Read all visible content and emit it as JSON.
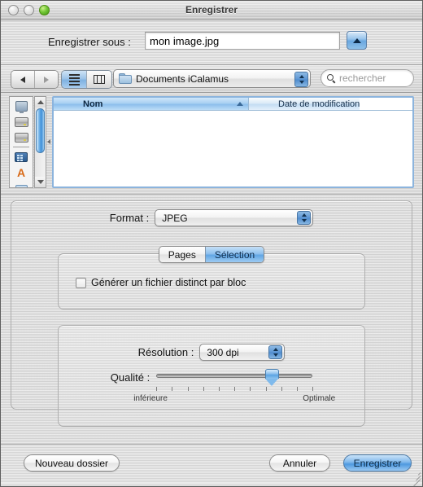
{
  "window": {
    "title": "Enregistrer",
    "traffic_lights": [
      {
        "name": "close",
        "state": "inactive"
      },
      {
        "name": "minimize",
        "state": "inactive"
      },
      {
        "name": "zoom",
        "state": "green"
      }
    ]
  },
  "saveas": {
    "label": "Enregistrer sous :",
    "filename": "mon image.jpg",
    "disclosure_icon": "triangle-up-icon"
  },
  "toolbar": {
    "back_icon": "arrow-left-icon",
    "forward_icon": "arrow-right-icon",
    "view_list_icon": "list-view-icon",
    "view_column_icon": "column-view-icon",
    "active_view": "list",
    "location": "Documents iCalamus",
    "location_icon": "folder-icon",
    "search_placeholder": "rechercher",
    "search_icon": "search-icon"
  },
  "sidebar": {
    "items": [
      {
        "name": "computer",
        "icon": "display-icon"
      },
      {
        "name": "disk-1",
        "icon": "hard-drive-icon"
      },
      {
        "name": "disk-2",
        "icon": "hard-drive-icon"
      },
      {
        "name": "separator",
        "icon": "separator"
      },
      {
        "name": "network",
        "icon": "server-icon"
      },
      {
        "name": "applications",
        "icon": "applications-icon",
        "glyph": "A"
      },
      {
        "name": "documents",
        "icon": "folder-icon"
      }
    ]
  },
  "filelist": {
    "columns": [
      {
        "label": "Nom",
        "sorted": true,
        "sort_icon": "sort-ascending-icon"
      },
      {
        "label": "Date de modification",
        "sorted": false
      }
    ],
    "rows": []
  },
  "options": {
    "format": {
      "label": "Format :",
      "value": "JPEG",
      "stepper_icon": "stepper-icon"
    },
    "scope": {
      "segments": [
        {
          "label": "Pages",
          "selected": false
        },
        {
          "label": "Sélection",
          "selected": true
        }
      ]
    },
    "split_files": {
      "label": "Générer un fichier distinct par bloc",
      "checked": false
    },
    "resolution": {
      "label": "Résolution :",
      "value": "300 dpi",
      "stepper_icon": "stepper-icon"
    },
    "quality": {
      "label": "Qualité :",
      "min_label": "inférieure",
      "max_label": "Optimale",
      "value_percent": 74,
      "tick_count": 11
    }
  },
  "footer": {
    "new_folder": "Nouveau dossier",
    "cancel": "Annuler",
    "save": "Enregistrer",
    "resize_icon": "resize-grip-icon"
  },
  "colors": {
    "accent": "#5ba3e2",
    "window_bg": "#d6d6d6",
    "header_blue": "#8dbfec"
  }
}
